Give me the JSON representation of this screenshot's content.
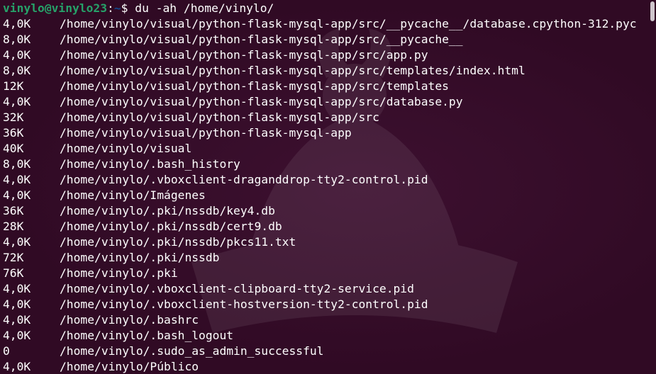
{
  "terminal": {
    "prompt": {
      "user_host": "vinylo@vinylo23",
      "separator": ":",
      "path": "~",
      "symbol": "$",
      "command": " du -ah /home/vinylo/"
    },
    "rows": [
      {
        "size": "4,0K",
        "path": "/home/vinylo/visual/python-flask-mysql-app/src/__pycache__/database.cpython-312.pyc"
      },
      {
        "size": "8,0K",
        "path": "/home/vinylo/visual/python-flask-mysql-app/src/__pycache__"
      },
      {
        "size": "4,0K",
        "path": "/home/vinylo/visual/python-flask-mysql-app/src/app.py"
      },
      {
        "size": "8,0K",
        "path": "/home/vinylo/visual/python-flask-mysql-app/src/templates/index.html"
      },
      {
        "size": "12K",
        "path": "/home/vinylo/visual/python-flask-mysql-app/src/templates"
      },
      {
        "size": "4,0K",
        "path": "/home/vinylo/visual/python-flask-mysql-app/src/database.py"
      },
      {
        "size": "32K",
        "path": "/home/vinylo/visual/python-flask-mysql-app/src"
      },
      {
        "size": "36K",
        "path": "/home/vinylo/visual/python-flask-mysql-app"
      },
      {
        "size": "40K",
        "path": "/home/vinylo/visual"
      },
      {
        "size": "8,0K",
        "path": "/home/vinylo/.bash_history"
      },
      {
        "size": "4,0K",
        "path": "/home/vinylo/.vboxclient-draganddrop-tty2-control.pid"
      },
      {
        "size": "4,0K",
        "path": "/home/vinylo/Imágenes"
      },
      {
        "size": "36K",
        "path": "/home/vinylo/.pki/nssdb/key4.db"
      },
      {
        "size": "28K",
        "path": "/home/vinylo/.pki/nssdb/cert9.db"
      },
      {
        "size": "4,0K",
        "path": "/home/vinylo/.pki/nssdb/pkcs11.txt"
      },
      {
        "size": "72K",
        "path": "/home/vinylo/.pki/nssdb"
      },
      {
        "size": "76K",
        "path": "/home/vinylo/.pki"
      },
      {
        "size": "4,0K",
        "path": "/home/vinylo/.vboxclient-clipboard-tty2-service.pid"
      },
      {
        "size": "4,0K",
        "path": "/home/vinylo/.vboxclient-hostversion-tty2-control.pid"
      },
      {
        "size": "4,0K",
        "path": "/home/vinylo/.bashrc"
      },
      {
        "size": "4,0K",
        "path": "/home/vinylo/.bash_logout"
      },
      {
        "size": "0",
        "path": "/home/vinylo/.sudo_as_admin_successful"
      },
      {
        "size": "4,0K",
        "path": "/home/vinylo/Público"
      }
    ]
  },
  "colors": {
    "background": "#300a24",
    "prompt_user": "#26a269",
    "prompt_path": "#12488b",
    "text": "#ffffff"
  },
  "icons": {
    "watermark": "ubuntu-mascot-watermark-icon"
  }
}
